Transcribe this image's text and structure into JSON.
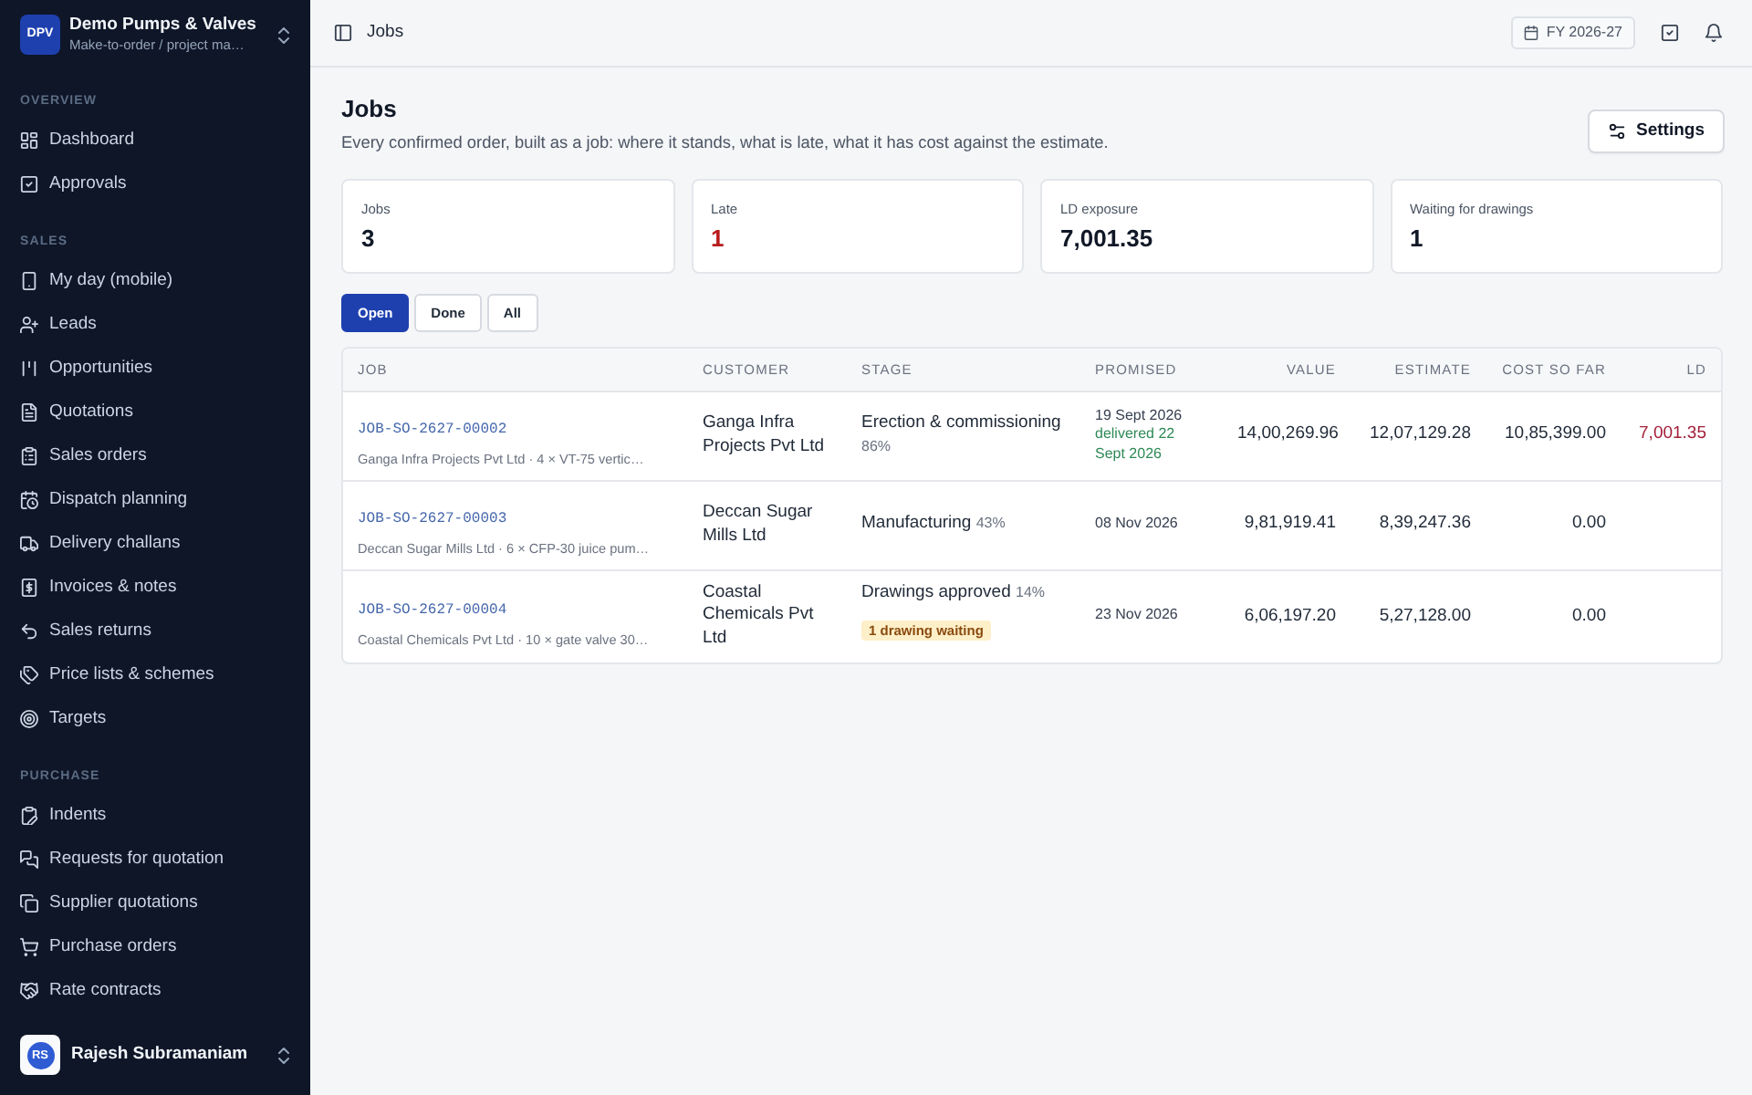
{
  "sidebar": {
    "brand": {
      "logo": "DPV",
      "name": "Demo Pumps & Valves",
      "subtitle": "Make-to-order / project ma…"
    },
    "sections": [
      {
        "title": "OVERVIEW",
        "items": [
          {
            "label": "Dashboard",
            "selected": false
          },
          {
            "label": "Approvals",
            "selected": false
          }
        ]
      },
      {
        "title": "SALES",
        "items": [
          {
            "label": "My day (mobile)",
            "selected": false
          },
          {
            "label": "Leads",
            "selected": false
          },
          {
            "label": "Opportunities",
            "selected": false
          },
          {
            "label": "Quotations",
            "selected": false
          },
          {
            "label": "Sales orders",
            "selected": false
          },
          {
            "label": "Dispatch planning",
            "selected": false
          },
          {
            "label": "Delivery challans",
            "selected": false
          },
          {
            "label": "Invoices & notes",
            "selected": false
          },
          {
            "label": "Sales returns",
            "selected": false
          },
          {
            "label": "Price lists & schemes",
            "selected": false
          },
          {
            "label": "Targets",
            "selected": false
          }
        ]
      },
      {
        "title": "PURCHASE",
        "items": [
          {
            "label": "Indents",
            "selected": false
          },
          {
            "label": "Requests for quotation",
            "selected": false
          },
          {
            "label": "Supplier quotations",
            "selected": false
          },
          {
            "label": "Purchase orders",
            "selected": false
          },
          {
            "label": "Rate contracts",
            "selected": false
          }
        ]
      }
    ],
    "user": {
      "initials": "RS",
      "name": "Rajesh Subramaniam"
    }
  },
  "topbar": {
    "title": "Jobs",
    "fiscal_year": "FY 2026-27"
  },
  "header": {
    "title": "Jobs",
    "description": "Every confirmed order, built as a job: where it stands, what is late, what it has cost against the estimate.",
    "settings_button": "Settings"
  },
  "stats": [
    {
      "label": "Jobs",
      "value": "3",
      "alert": false
    },
    {
      "label": "Late",
      "value": "1",
      "alert": true
    },
    {
      "label": "LD exposure",
      "value": "7,001.35",
      "alert": false
    },
    {
      "label": "Waiting for drawings",
      "value": "1",
      "alert": false
    }
  ],
  "filters": [
    {
      "label": "Open",
      "selected": true
    },
    {
      "label": "Done",
      "selected": false
    },
    {
      "label": "All",
      "selected": false
    }
  ],
  "table": {
    "columns": [
      {
        "label": "JOB",
        "kind": "text"
      },
      {
        "label": "CUSTOMER",
        "kind": "text"
      },
      {
        "label": "STAGE",
        "kind": "text"
      },
      {
        "label": "PROMISED",
        "kind": "text"
      },
      {
        "label": "VALUE",
        "kind": "amount"
      },
      {
        "label": "ESTIMATE",
        "kind": "amount"
      },
      {
        "label": "COST SO FAR",
        "kind": "amount"
      },
      {
        "label": "LD",
        "kind": "amount"
      }
    ],
    "rows": [
      {
        "job_id": "JOB-SO-2627-00002",
        "summary": "Ganga Infra Projects Pvt Ltd · 4 × VT-75 vertic…",
        "customer": "Ganga Infra Projects Pvt Ltd",
        "stage": "Erection & commissioning 86%",
        "promised": "19 Sept 2026",
        "delivered": "delivered 22 Sept 2026",
        "value": "14,00,269.96",
        "estimate": "12,07,129.28",
        "cost_so_far": "10,85,399.00",
        "ld": "7,001.35"
      },
      {
        "job_id": "JOB-SO-2627-00003",
        "summary": "Deccan Sugar Mills Ltd · 6 × CFP-30 juice pum…",
        "customer": "Deccan Sugar Mills Ltd",
        "stage": "Manufacturing 43%",
        "promised": "08 Nov 2026",
        "value": "9,81,919.41",
        "estimate": "8,39,247.36",
        "cost_so_far": "0.00"
      },
      {
        "job_id": "JOB-SO-2627-00004",
        "summary": "Coastal Chemicals Pvt Ltd · 10 × gate valve 30…",
        "customer": "Coastal Chemicals Pvt Ltd",
        "stage": "Drawings approved 14%",
        "flag": "1 drawing waiting",
        "promised": "23 Nov 2026",
        "value": "6,06,197.20",
        "estimate": "5,27,128.00",
        "cost_so_far": "0.00"
      }
    ]
  }
}
